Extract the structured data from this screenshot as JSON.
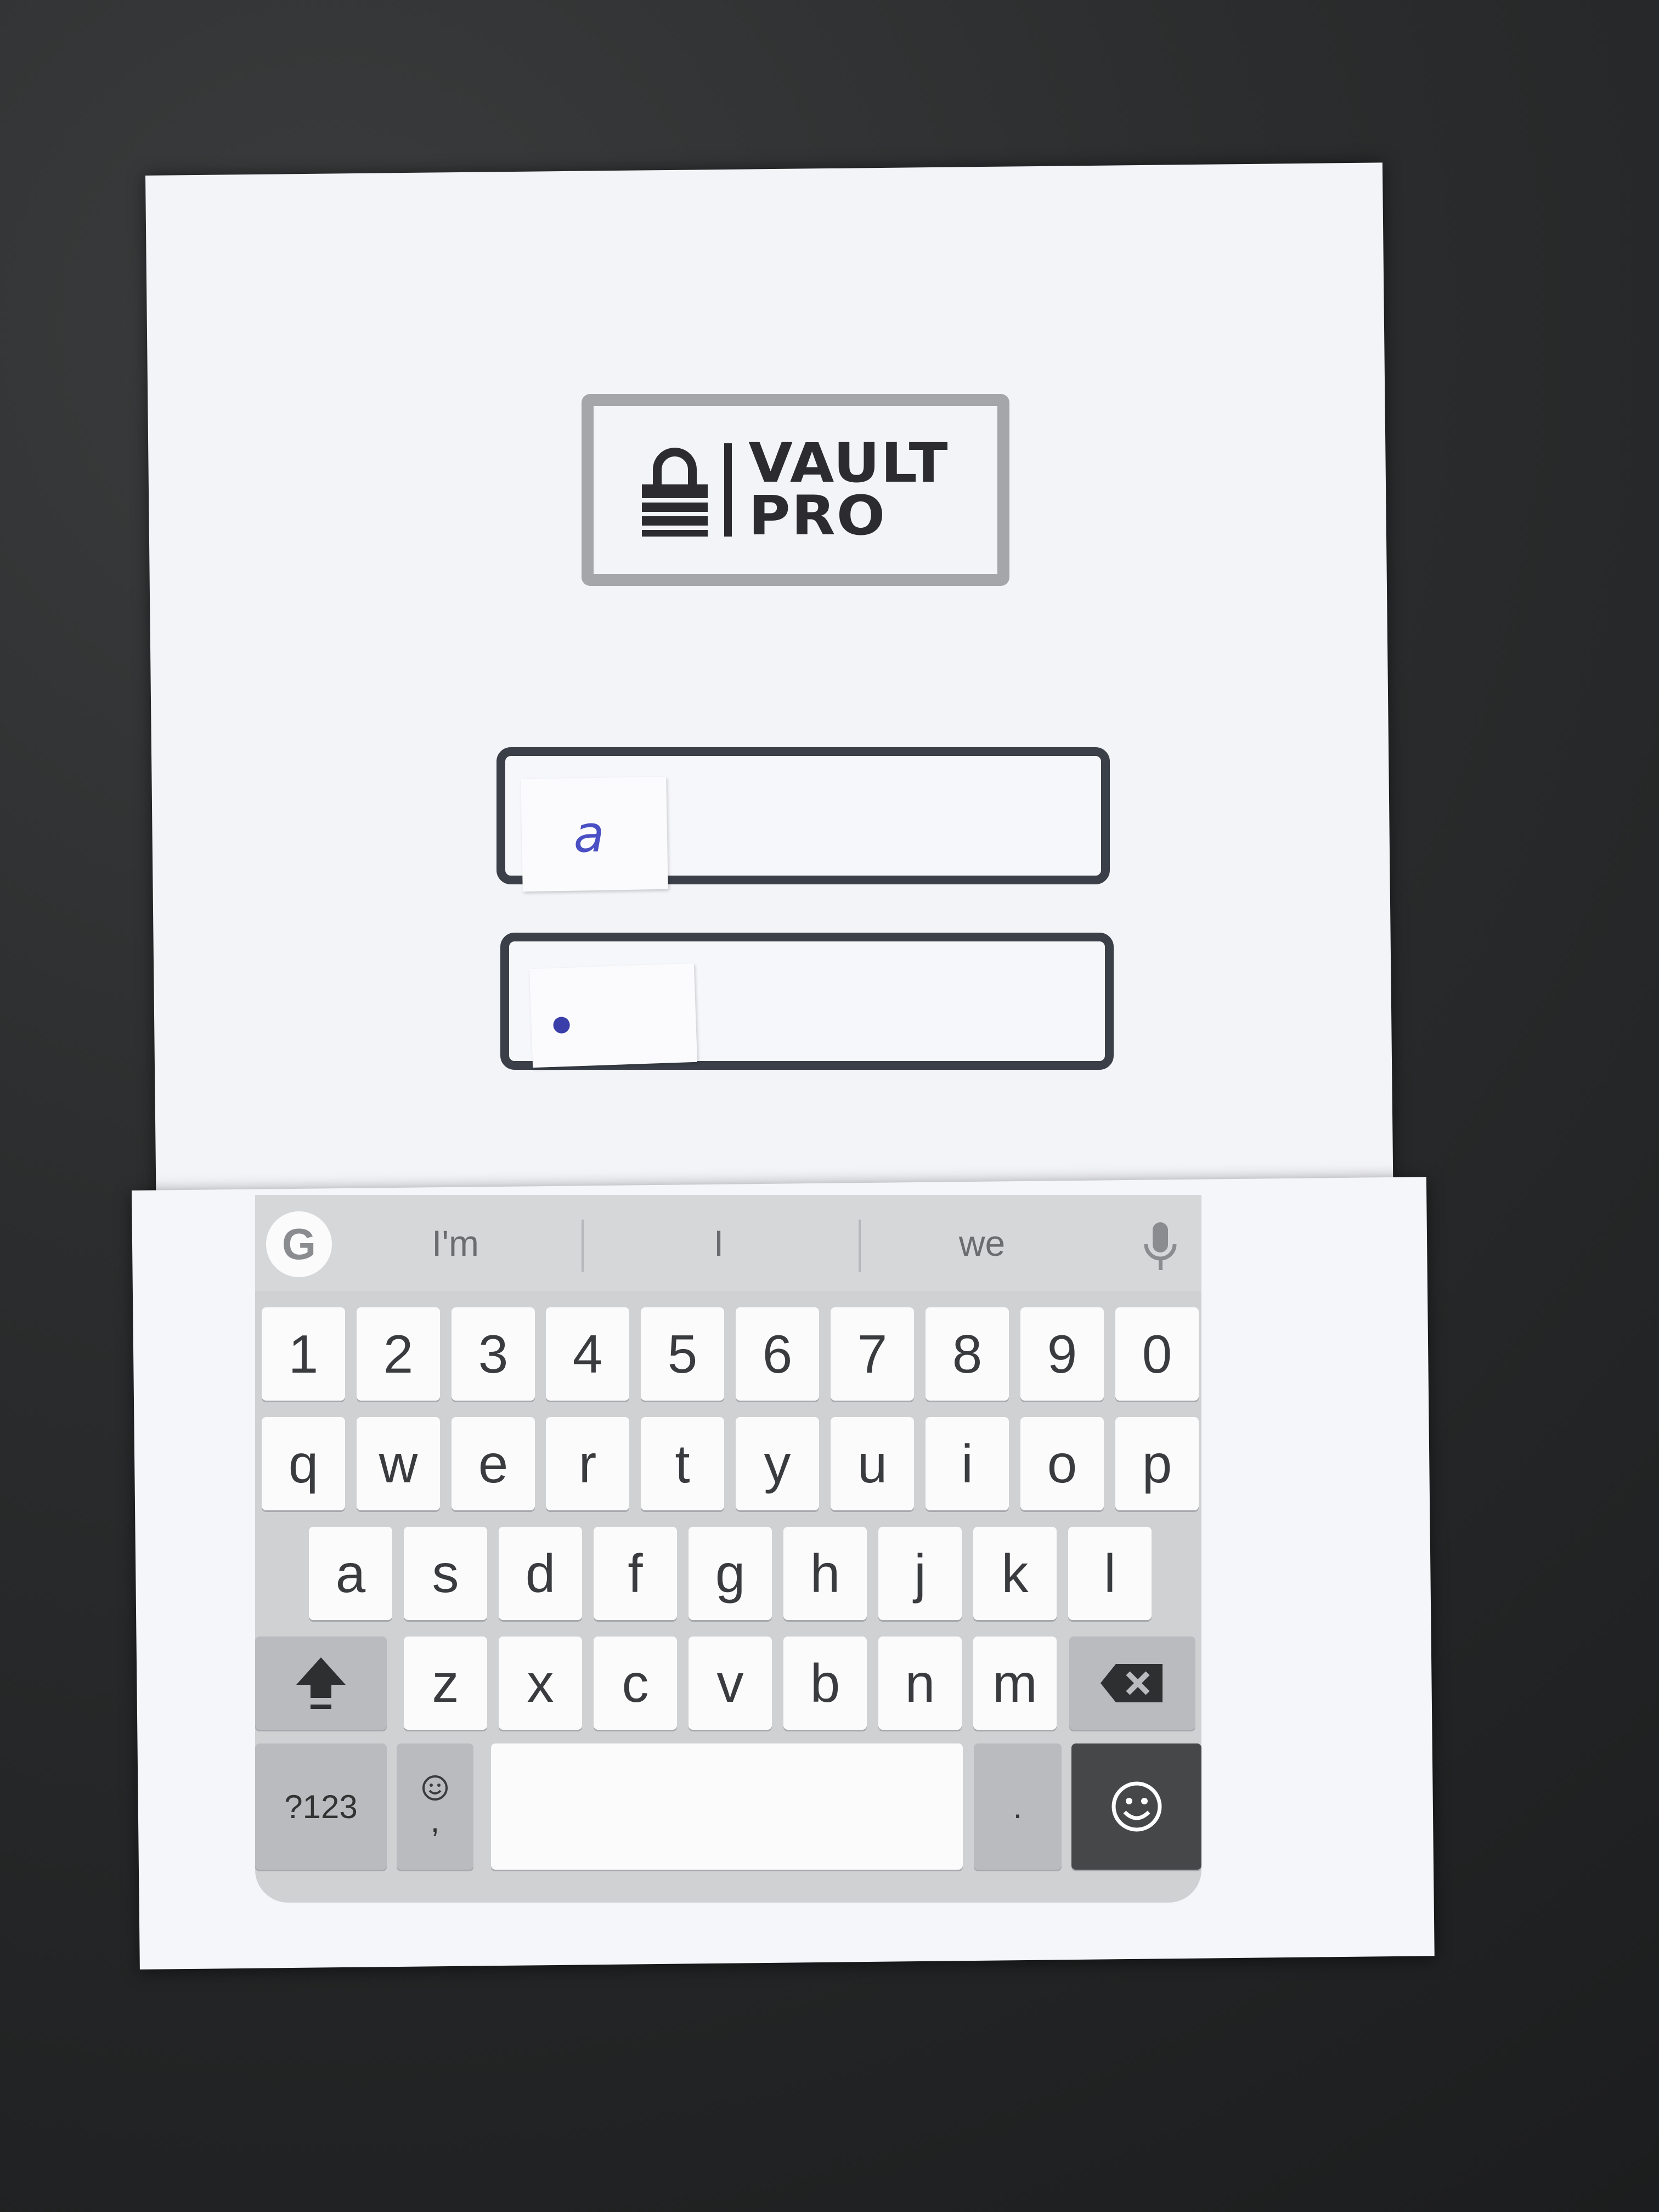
{
  "logo": {
    "line1": "VAULT",
    "line2": "PRO"
  },
  "login_form": {
    "username_value": "a",
    "password_value": "●"
  },
  "keyboard": {
    "google_icon": "G",
    "suggestions": [
      "I'm",
      "I",
      "we"
    ],
    "number_row": [
      "1",
      "2",
      "3",
      "4",
      "5",
      "6",
      "7",
      "8",
      "9",
      "0"
    ],
    "row1": [
      "q",
      "w",
      "e",
      "r",
      "t",
      "y",
      "u",
      "i",
      "o",
      "p"
    ],
    "row2": [
      "a",
      "s",
      "d",
      "f",
      "g",
      "h",
      "j",
      "k",
      "l"
    ],
    "row3": [
      "z",
      "x",
      "c",
      "v",
      "b",
      "n",
      "m"
    ],
    "symbols_label": "?123",
    "comma_label": ",",
    "period_label": ".",
    "icons": {
      "shift": "shift-arrow-icon",
      "backspace": "backspace-icon",
      "emoji": "smiley-icon",
      "mic": "microphone-icon"
    }
  }
}
